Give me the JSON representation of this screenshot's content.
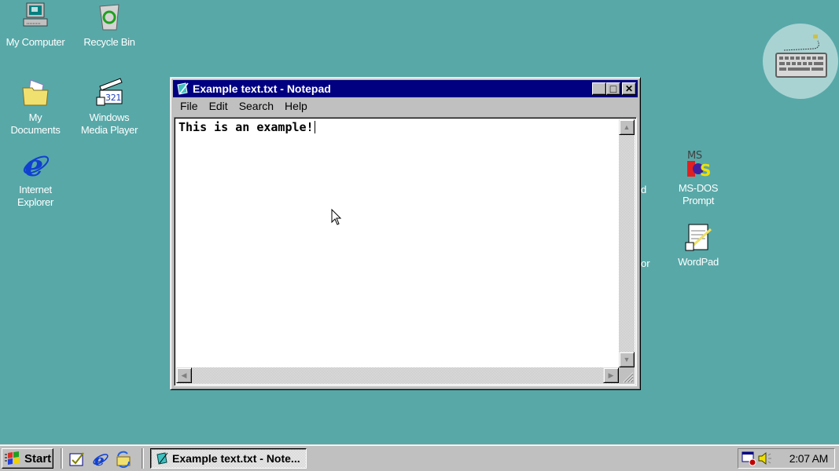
{
  "desktop": {
    "icons": [
      {
        "label": "My Computer",
        "icon": "my-computer-icon"
      },
      {
        "label": "Recycle Bin",
        "icon": "recycle-bin-icon"
      },
      {
        "label": "My\nDocuments",
        "icon": "my-documents-icon"
      },
      {
        "label": "Windows\nMedia Player",
        "icon": "media-player-icon"
      },
      {
        "label": "Internet\nExplorer",
        "icon": "internet-explorer-icon"
      },
      {
        "label": "MS-DOS\nPrompt",
        "icon": "ms-dos-icon"
      },
      {
        "label": "WordPad",
        "icon": "wordpad-icon"
      }
    ],
    "hidden_fragments": [
      "d",
      "or"
    ]
  },
  "window": {
    "title": "Example text.txt - Notepad",
    "buttons": {
      "minimize": "_",
      "maximize": "□",
      "close": "✕"
    },
    "menu": [
      "File",
      "Edit",
      "Search",
      "Help"
    ],
    "content": "This is an example!"
  },
  "taskbar": {
    "start_label": "Start",
    "quick_launch": [
      "show-desktop-icon",
      "internet-explorer-icon",
      "channels-icon"
    ],
    "task_label": "Example text.txt - Note...",
    "clock": "2:07 AM",
    "tray_icons": [
      "scheduler-icon",
      "volume-icon"
    ]
  },
  "colors": {
    "desktop": "#58a8a8",
    "titlebar": "#000080",
    "face": "#c0c0c0"
  }
}
